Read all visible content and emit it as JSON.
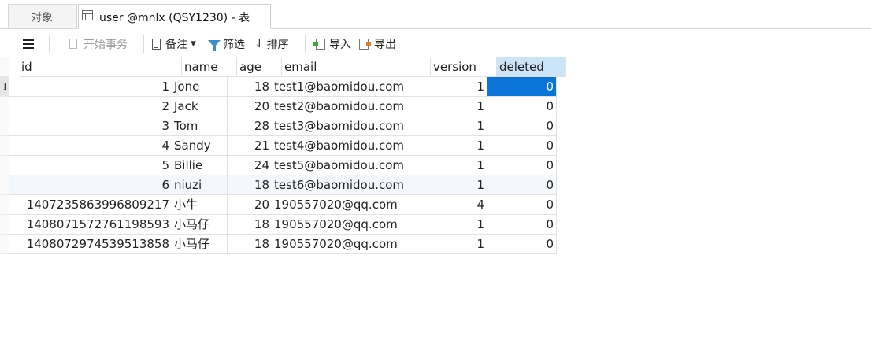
{
  "tabs": [
    {
      "label": "对象"
    },
    {
      "label": "user @mnlx (QSY1230) - 表"
    }
  ],
  "toolbar": {
    "begin_transaction": "开始事务",
    "note": "备注",
    "filter": "筛选",
    "sort": "排序",
    "import": "导入",
    "export": "导出"
  },
  "grid": {
    "columns": [
      "id",
      "name",
      "age",
      "email",
      "version",
      "deleted"
    ],
    "selected_column": "deleted",
    "current_row_marker": "I",
    "rows": [
      {
        "id": "1",
        "name": "Jone",
        "age": "18",
        "email": "test1@baomidou.com",
        "version": "1",
        "deleted": "0"
      },
      {
        "id": "2",
        "name": "Jack",
        "age": "20",
        "email": "test2@baomidou.com",
        "version": "1",
        "deleted": "0"
      },
      {
        "id": "3",
        "name": "Tom",
        "age": "28",
        "email": "test3@baomidou.com",
        "version": "1",
        "deleted": "0"
      },
      {
        "id": "4",
        "name": "Sandy",
        "age": "21",
        "email": "test4@baomidou.com",
        "version": "1",
        "deleted": "0"
      },
      {
        "id": "5",
        "name": "Billie",
        "age": "24",
        "email": "test5@baomidou.com",
        "version": "1",
        "deleted": "0"
      },
      {
        "id": "6",
        "name": "niuzi",
        "age": "18",
        "email": "test6@baomidou.com",
        "version": "1",
        "deleted": "0"
      },
      {
        "id": "1407235863996809217",
        "name": "小牛",
        "age": "20",
        "email": "190557020@qq.com",
        "version": "4",
        "deleted": "0"
      },
      {
        "id": "1408071572761198593",
        "name": "小马仔",
        "age": "18",
        "email": "190557020@qq.com",
        "version": "1",
        "deleted": "0"
      },
      {
        "id": "1408072974539513858",
        "name": "小马仔",
        "age": "18",
        "email": "190557020@qq.com",
        "version": "1",
        "deleted": "0"
      }
    ]
  },
  "colors": {
    "selection": "#0a74d9",
    "header_selected": "#cce4f7",
    "alt_row": "#f4f8fc"
  }
}
